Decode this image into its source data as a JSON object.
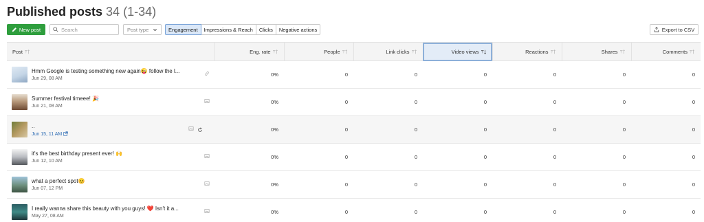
{
  "header": {
    "title": "Published posts",
    "count": "34 (1-34)"
  },
  "toolbar": {
    "new_post_label": "New post",
    "search_placeholder": "Search",
    "search_value": "",
    "post_type_label": "Post type",
    "tabs": [
      {
        "label": "Engagement",
        "active": true
      },
      {
        "label": "Impressions & Reach",
        "active": false
      },
      {
        "label": "Clicks",
        "active": false
      },
      {
        "label": "Negative actions",
        "active": false
      }
    ],
    "export_label": "Export to CSV"
  },
  "table": {
    "columns": [
      "Post",
      "Eng. rate",
      "People",
      "Link clicks",
      "Video views",
      "Reactions",
      "Shares",
      "Comments"
    ],
    "sorted_column": "Video views",
    "rows": [
      {
        "text": "Hmm Google is testing something new again😜 follow the l...",
        "date": "Jun 29, 08 AM",
        "type_icon": "link-icon",
        "eng_rate": "0%",
        "people": "0",
        "link_clicks": "0",
        "video_views": "0",
        "reactions": "0",
        "shares": "0",
        "comments": "0"
      },
      {
        "text": "Summer festival timeee! 🎉",
        "date": "Jun 21, 08 AM",
        "type_icon": "image-icon",
        "eng_rate": "0%",
        "people": "0",
        "link_clicks": "0",
        "video_views": "0",
        "reactions": "0",
        "shares": "0",
        "comments": "0"
      },
      {
        "text": "..",
        "date": "Jun 15, 11 AM",
        "type_icon": "image-icon",
        "eng_rate": "0%",
        "people": "0",
        "link_clicks": "0",
        "video_views": "0",
        "reactions": "0",
        "shares": "0",
        "comments": "0"
      },
      {
        "text": "it's the best birthday present ever! 🙌",
        "date": "Jun 12, 10 AM",
        "type_icon": "image-icon",
        "eng_rate": "0%",
        "people": "0",
        "link_clicks": "0",
        "video_views": "0",
        "reactions": "0",
        "shares": "0",
        "comments": "0"
      },
      {
        "text": "what a perfect spot😊",
        "date": "Jun 07, 12 PM",
        "type_icon": "image-icon",
        "eng_rate": "0%",
        "people": "0",
        "link_clicks": "0",
        "video_views": "0",
        "reactions": "0",
        "shares": "0",
        "comments": "0"
      },
      {
        "text": "I really wanna share this beauty with you guys! ❤️ Isn't it a...",
        "date": "May 27, 08 AM",
        "type_icon": "image-icon",
        "eng_rate": "0%",
        "people": "0",
        "link_clicks": "0",
        "video_views": "0",
        "reactions": "0",
        "shares": "0",
        "comments": "0"
      }
    ]
  },
  "colors": {
    "primary_green": "#2e9e3d",
    "active_tab": "#dbe8f8",
    "link_blue": "#2f6db5"
  }
}
